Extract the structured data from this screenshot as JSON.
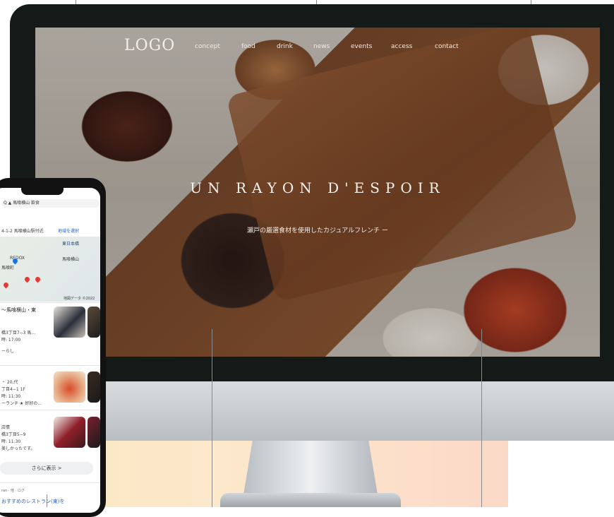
{
  "site": {
    "logo": "LOGO",
    "nav": [
      "concept",
      "food",
      "drink",
      "news",
      "events",
      "access",
      "contact"
    ],
    "hero_title": "UN RAYON D'ESPOIR",
    "hero_subtitle": "瀬戸の厳選食材を使用したカジュアルフレンチ ー"
  },
  "phone": {
    "search_bar": "Q ▲ 馬喰横山 飲食",
    "location": "4-1-2 馬喰横山駅付近",
    "area_link": "地域を選択",
    "map_labels": [
      "東日本橋",
      "REDOX",
      "馬喰町",
      "馬喰横山"
    ],
    "map_footer": "地図データ ©2022",
    "results": [
      {
        "title": "〜馬喰横山・東",
        "lines": [
          "橋3丁目7−3 馬...",
          "時: 17:00",
          "ーらし"
        ]
      },
      {
        "title": "",
        "lines": [
          "・ 20,代",
          "丁目4−1 1F",
          "時: 11:30",
          "ーランチ ★ 好好の..."
        ]
      },
      {
        "title": "",
        "lines": [
          "店情",
          "橋3丁目5−9",
          "時: 11:30",
          "美しかったです。"
        ]
      }
    ],
    "more_button": "さらに表示  >",
    "footer_small": "ran · 他 · ログ",
    "footer_link": "おすすめのレストラン(東)を"
  },
  "colors": {
    "monitor_bezel": "#141a18",
    "link_blue": "#2a62c9"
  }
}
